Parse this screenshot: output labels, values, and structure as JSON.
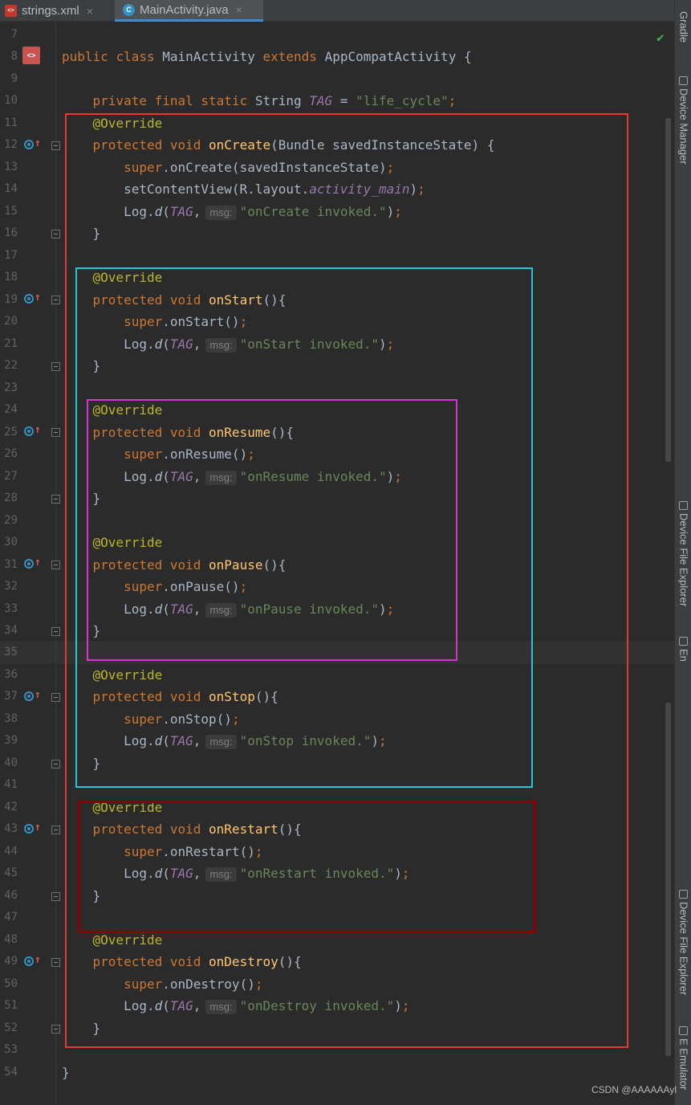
{
  "tabs": [
    {
      "label": "strings.xml",
      "icon": "xml-file-icon",
      "active": false
    },
    {
      "label": "MainActivity.java",
      "icon": "java-class-icon",
      "active": true
    }
  ],
  "close_glyph": "×",
  "status_check": "✔",
  "watermark": "CSDN @AAAAAAyl",
  "right_toolbar": [
    "Gradle",
    "Device Manager",
    "Device File Explorer",
    "En",
    "Device File Explorer",
    "E Emulator"
  ],
  "highlight_colors": {
    "red": "#e53935",
    "cyan": "#26c6da",
    "magenta": "#d633d6",
    "darkred": "#8b0000"
  },
  "code": {
    "line_numbers": [
      "7",
      "8",
      "9",
      "10",
      "11",
      "12",
      "13",
      "14",
      "15",
      "16",
      "17",
      "18",
      "19",
      "20",
      "21",
      "22",
      "23",
      "24",
      "25",
      "26",
      "27",
      "28",
      "29",
      "30",
      "31",
      "32",
      "33",
      "34",
      "35",
      "36",
      "37",
      "38",
      "39",
      "40",
      "41",
      "42",
      "43",
      "44",
      "45",
      "46",
      "47",
      "48",
      "49",
      "50",
      "51",
      "52",
      "53",
      "54"
    ],
    "class_decl": {
      "public": "public",
      "class": "class",
      "name": "MainActivity",
      "extends": "extends",
      "parent": "AppCompatActivity",
      "brace": " {"
    },
    "tag_field": {
      "mods": "private final static",
      "type": "String",
      "name": "TAG",
      "eq": " = ",
      "value": "\"life_cycle\"",
      "semi": ";"
    },
    "annotation": "@Override",
    "protected_void": "protected void",
    "super": "super",
    "log": "Log.",
    "log_d": "d",
    "tag": "TAG",
    "msg_hint": "msg:",
    "close_brace": "}",
    "on_create": {
      "name": "onCreate",
      "params": "(Bundle savedInstanceState) {",
      "super_call": ".onCreate(savedInstanceState)",
      "set_content": "setContentView(R.layout.",
      "layout": "activity_main",
      "message": "\"onCreate invoked.\""
    },
    "on_start": {
      "name": "onStart",
      "params": "(){",
      "super_call": ".onStart()",
      "message": "\"onStart invoked.\""
    },
    "on_resume": {
      "name": "onResume",
      "params": "(){",
      "super_call": ".onResume()",
      "message": "\"onResume invoked.\""
    },
    "on_pause": {
      "name": "onPause",
      "params": "(){",
      "super_call": ".onPause()",
      "message": "\"onPause invoked.\""
    },
    "on_stop": {
      "name": "onStop",
      "params": "(){",
      "super_call": ".onStop()",
      "message": "\"onStop invoked.\""
    },
    "on_restart": {
      "name": "onRestart",
      "params": "(){",
      "super_call": ".onRestart()",
      "message": "\"onRestart invoked.\""
    },
    "on_destroy": {
      "name": "onDestroy",
      "params": "(){",
      "super_call": ".onDestroy()",
      "message": "\"onDestroy invoked.\""
    }
  }
}
